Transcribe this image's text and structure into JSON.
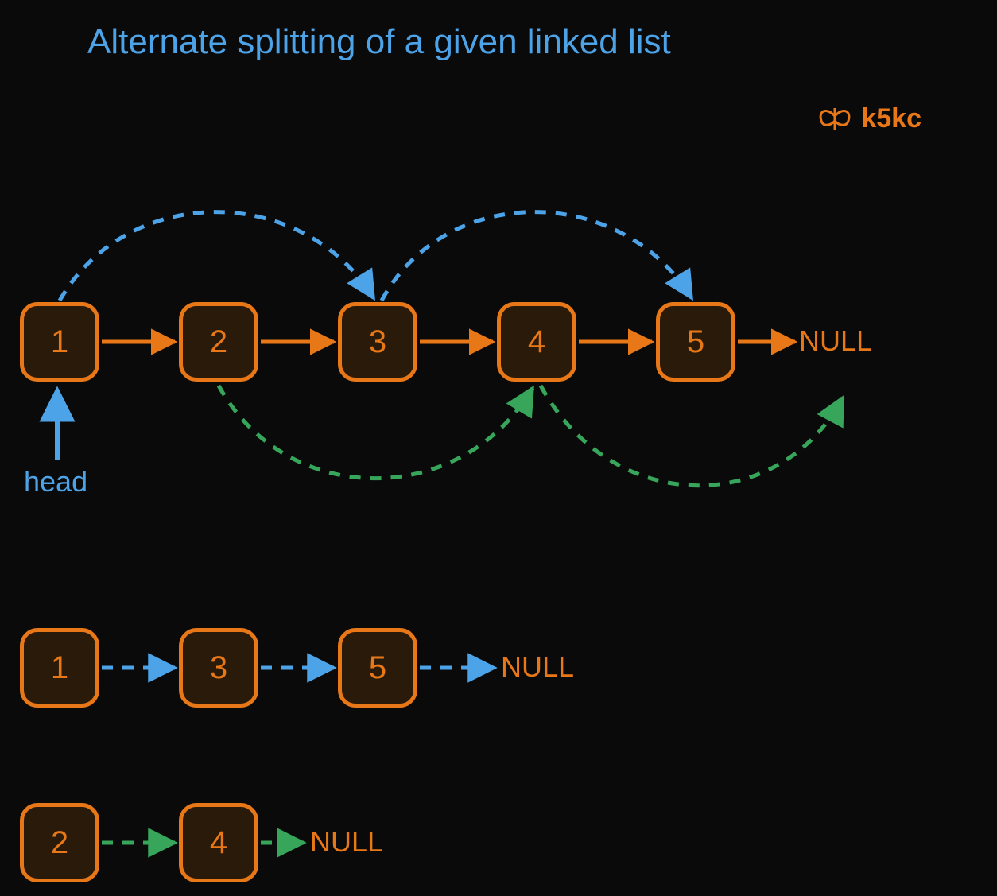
{
  "title": "Alternate splitting of a given linked list",
  "brand": "k5kc",
  "head_label": "head",
  "null_label": "NULL",
  "main_list": {
    "nodes": [
      "1",
      "2",
      "3",
      "4",
      "5"
    ],
    "terminal": "NULL"
  },
  "odd_list": {
    "nodes": [
      "1",
      "3",
      "5"
    ],
    "terminal": "NULL",
    "color": "blue"
  },
  "even_list": {
    "nodes": [
      "2",
      "4"
    ],
    "terminal": "NULL",
    "color": "green"
  },
  "colors": {
    "bg": "#0a0a0a",
    "orange": "#e87817",
    "blue": "#4da3e8",
    "green": "#37a65b",
    "node_fill": "#2a1a0a"
  },
  "diagram": {
    "description": "A linked list of 5 nodes (1→2→3→4→5→NULL) shown being split by alternating position. Blue dashed arcs above connect odd-position nodes (1→3→5). Green dashed arcs below connect even-position nodes (2→4→NULL). Two resulting lists shown below: 1→3→5→NULL (blue dashed arrows) and 2→4→NULL (green dashed arrows). 'head' label points up at node 1.",
    "top_arcs_blue": [
      "1→3",
      "3→5"
    ],
    "bottom_arcs_green": [
      "2→4",
      "4→NULL"
    ]
  }
}
